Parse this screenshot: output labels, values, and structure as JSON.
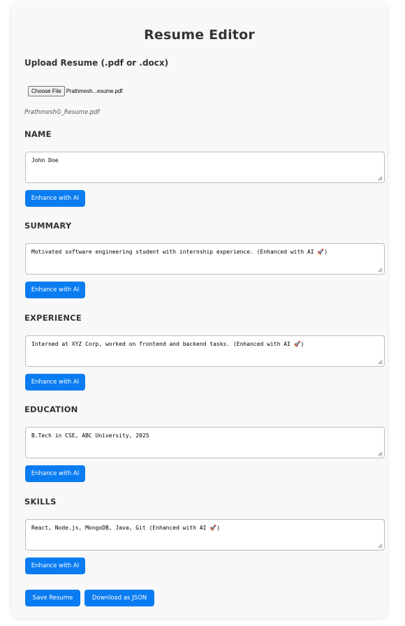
{
  "page_title": "Resume Editor",
  "upload": {
    "label": "Upload Resume (.pdf or .docx)",
    "choose_button": "Choose File",
    "chosen_file_truncated": "Prathmesh...esume.pdf",
    "selected_file_name": "PrathmeshG_Resume.pdf"
  },
  "sections": [
    {
      "label": "NAME",
      "value": "John Doe",
      "enhance_label": "Enhance with AI"
    },
    {
      "label": "SUMMARY",
      "value": "Motivated software engineering student with internship experience. (Enhanced with AI 🚀)",
      "enhance_label": "Enhance with AI"
    },
    {
      "label": "EXPERIENCE",
      "value": "Interned at XYZ Corp, worked on frontend and backend tasks. (Enhanced with AI 🚀)",
      "enhance_label": "Enhance with AI"
    },
    {
      "label": "EDUCATION",
      "value": "B.Tech in CSE, ABC University, 2025",
      "enhance_label": "Enhance with AI"
    },
    {
      "label": "SKILLS",
      "value": "React, Node.js, MongoDB, Java, Git (Enhanced with AI 🚀)",
      "enhance_label": "Enhance with AI"
    }
  ],
  "actions": {
    "save_label": "Save Resume",
    "download_label": "Download as JSON"
  },
  "colors": {
    "accent": "#0a7cf2",
    "card_bg": "#f8f8f8"
  }
}
